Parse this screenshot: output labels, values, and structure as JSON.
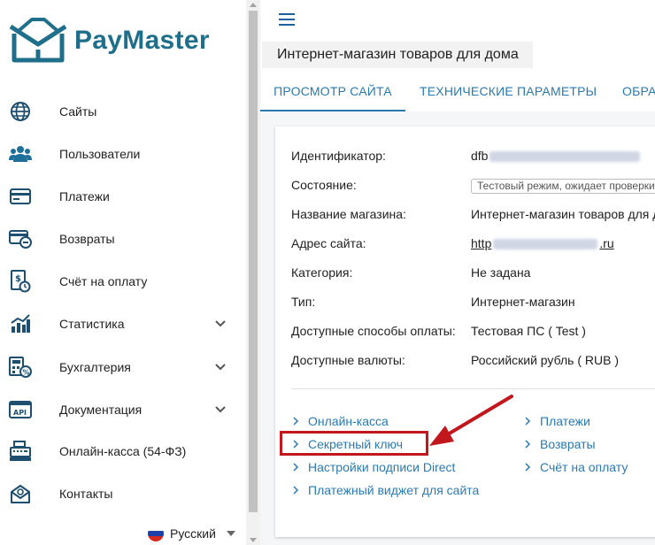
{
  "brand": {
    "name": "PayMaster",
    "color": "#1f6f8b"
  },
  "sidebar": {
    "items": [
      {
        "label": "Сайты",
        "icon": "globe-icon",
        "has_submenu": false
      },
      {
        "label": "Пользователи",
        "icon": "users-icon",
        "has_submenu": false
      },
      {
        "label": "Платежи",
        "icon": "credit-card-icon",
        "has_submenu": false
      },
      {
        "label": "Возвраты",
        "icon": "refund-icon",
        "has_submenu": false
      },
      {
        "label": "Счёт на оплату",
        "icon": "invoice-icon",
        "has_submenu": false
      },
      {
        "label": "Статистика",
        "icon": "bar-chart-icon",
        "has_submenu": true
      },
      {
        "label": "Бухгалтерия",
        "icon": "accounting-icon",
        "has_submenu": true
      },
      {
        "label": "Документация",
        "icon": "api-doc-icon",
        "has_submenu": true
      },
      {
        "label": "Онлайн-касса (54-ФЗ)",
        "icon": "cash-register-icon",
        "has_submenu": false
      },
      {
        "label": "Контакты",
        "icon": "contact-mail-icon",
        "has_submenu": false
      }
    ],
    "language": {
      "label": "Русский",
      "flag_icon": "russia-flag-icon"
    }
  },
  "header": {
    "page_title": "Интернет-магазин товаров для дома",
    "tabs": [
      {
        "label": "ПРОСМОТР САЙТА",
        "active": true
      },
      {
        "label": "ТЕХНИЧЕСКИЕ ПАРАМЕТРЫ",
        "active": false
      },
      {
        "label": "ОБРА",
        "active": false
      }
    ]
  },
  "site_info": {
    "rows": [
      {
        "key": "Идентификатор:",
        "value": "dfb"
      },
      {
        "key": "Состояние:",
        "value": "Тестовый режим, ожидает проверки"
      },
      {
        "key": "Название магазина:",
        "value": "Интернет-магазин товаров для д"
      },
      {
        "key": "Адрес сайта:",
        "value": "http",
        "value_suffix": ".ru"
      },
      {
        "key": "Категория:",
        "value": "Не задана"
      },
      {
        "key": "Тип:",
        "value": "Интернет-магазин"
      },
      {
        "key": "Доступные способы оплаты:",
        "value": "Тестовая ПС ( Test )"
      },
      {
        "key": "Доступные валюты:",
        "value": "Российский рубль ( RUB )"
      }
    ]
  },
  "links": {
    "left": [
      "Онлайн-касса",
      "Секретный ключ",
      "Настройки подписи Direct",
      "Платежный виджет для сайта"
    ],
    "right": [
      "Платежи",
      "Возвраты",
      "Счёт на оплату"
    ]
  },
  "colors": {
    "accent": "#2a7ab0",
    "highlight": "#c2171d",
    "link": "#1a4fb3"
  }
}
